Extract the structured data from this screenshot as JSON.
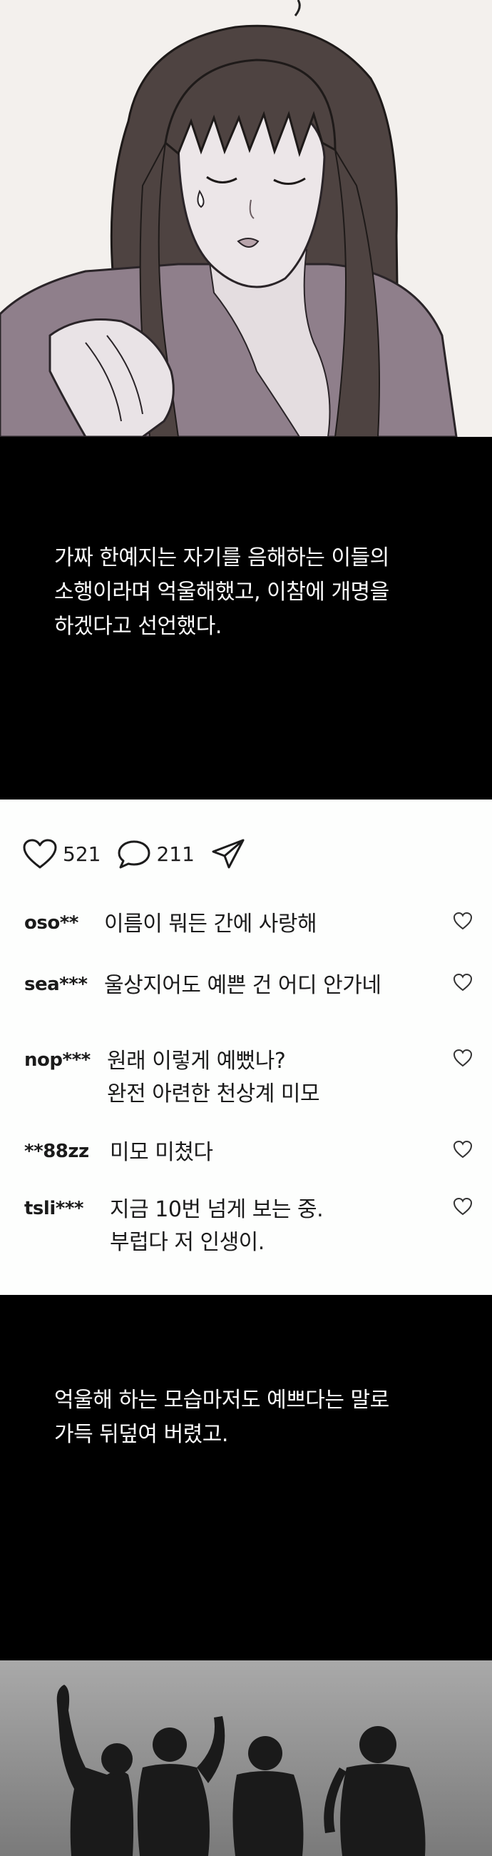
{
  "narration_1": {
    "lines": [
      "가짜 한예지는 자기를 음해하는 이들의",
      "소행이라며 억울해했고, 이참에 개명을",
      "하겠다고 선언했다."
    ]
  },
  "post": {
    "likes": "521",
    "comments": "211",
    "comment_list": [
      {
        "user": "oso**",
        "lines": [
          "이름이 뭐든 간에 사랑해"
        ]
      },
      {
        "user": "sea***",
        "lines": [
          "울상지어도 예쁜 건 어디 안가네"
        ]
      },
      {
        "user": "nop***",
        "lines": [
          "원래 이렇게 예뻤나?",
          "완전 아련한 천상계 미모"
        ]
      },
      {
        "user": "**88zz",
        "lines": [
          "미모 미쳤다"
        ]
      },
      {
        "user": "tsli***",
        "lines": [
          "지금 10번 넘게 보는 중.",
          "부럽다 저 인생이."
        ]
      }
    ]
  },
  "narration_2": {
    "lines": [
      "억울해 하는 모습마저도 예쁘다는 말로",
      "가득 뒤덮여 버렸고."
    ]
  },
  "colors": {
    "narration_background": "#000000",
    "narration_text": "#ffffff",
    "post_background": "#fdfefd",
    "post_text": "#1c1c1c"
  },
  "icons": {
    "like": "heart-outline-icon",
    "comment": "speech-bubble-icon",
    "share": "paper-plane-icon",
    "comment_like": "small-heart-outline-icon"
  }
}
